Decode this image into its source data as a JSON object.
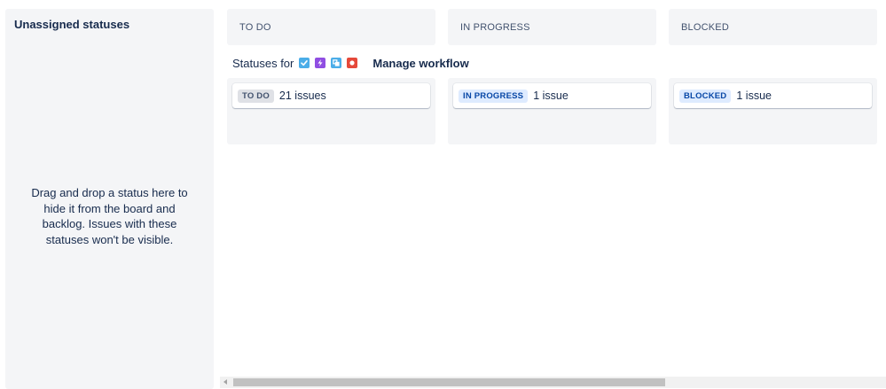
{
  "unassigned": {
    "title": "Unassigned statuses",
    "hint": "Drag and drop a status here to hide it from the board and backlog. Issues with these statuses won't be visible."
  },
  "columns": [
    {
      "header": "TO DO",
      "status": "TO DO",
      "count": "21 issues",
      "lozenge_bg": "#dfe1e6",
      "lozenge_fg": "#42526e"
    },
    {
      "header": "IN PROGRESS",
      "status": "IN PROGRESS",
      "count": "1 issue",
      "lozenge_bg": "#deebff",
      "lozenge_fg": "#0747a6"
    },
    {
      "header": "BLOCKED",
      "status": "BLOCKED",
      "count": "1 issue",
      "lozenge_bg": "#deebff",
      "lozenge_fg": "#0747a6"
    }
  ],
  "workflow": {
    "statuses_for_label": "Statuses for",
    "issue_type_icons": [
      {
        "name": "task-icon",
        "color": "#4bade8"
      },
      {
        "name": "epic-icon",
        "color": "#904ee2"
      },
      {
        "name": "subtask-icon",
        "color": "#4bade8"
      },
      {
        "name": "bug-icon",
        "color": "#e5493a"
      }
    ],
    "manage_label": "Manage workflow"
  }
}
